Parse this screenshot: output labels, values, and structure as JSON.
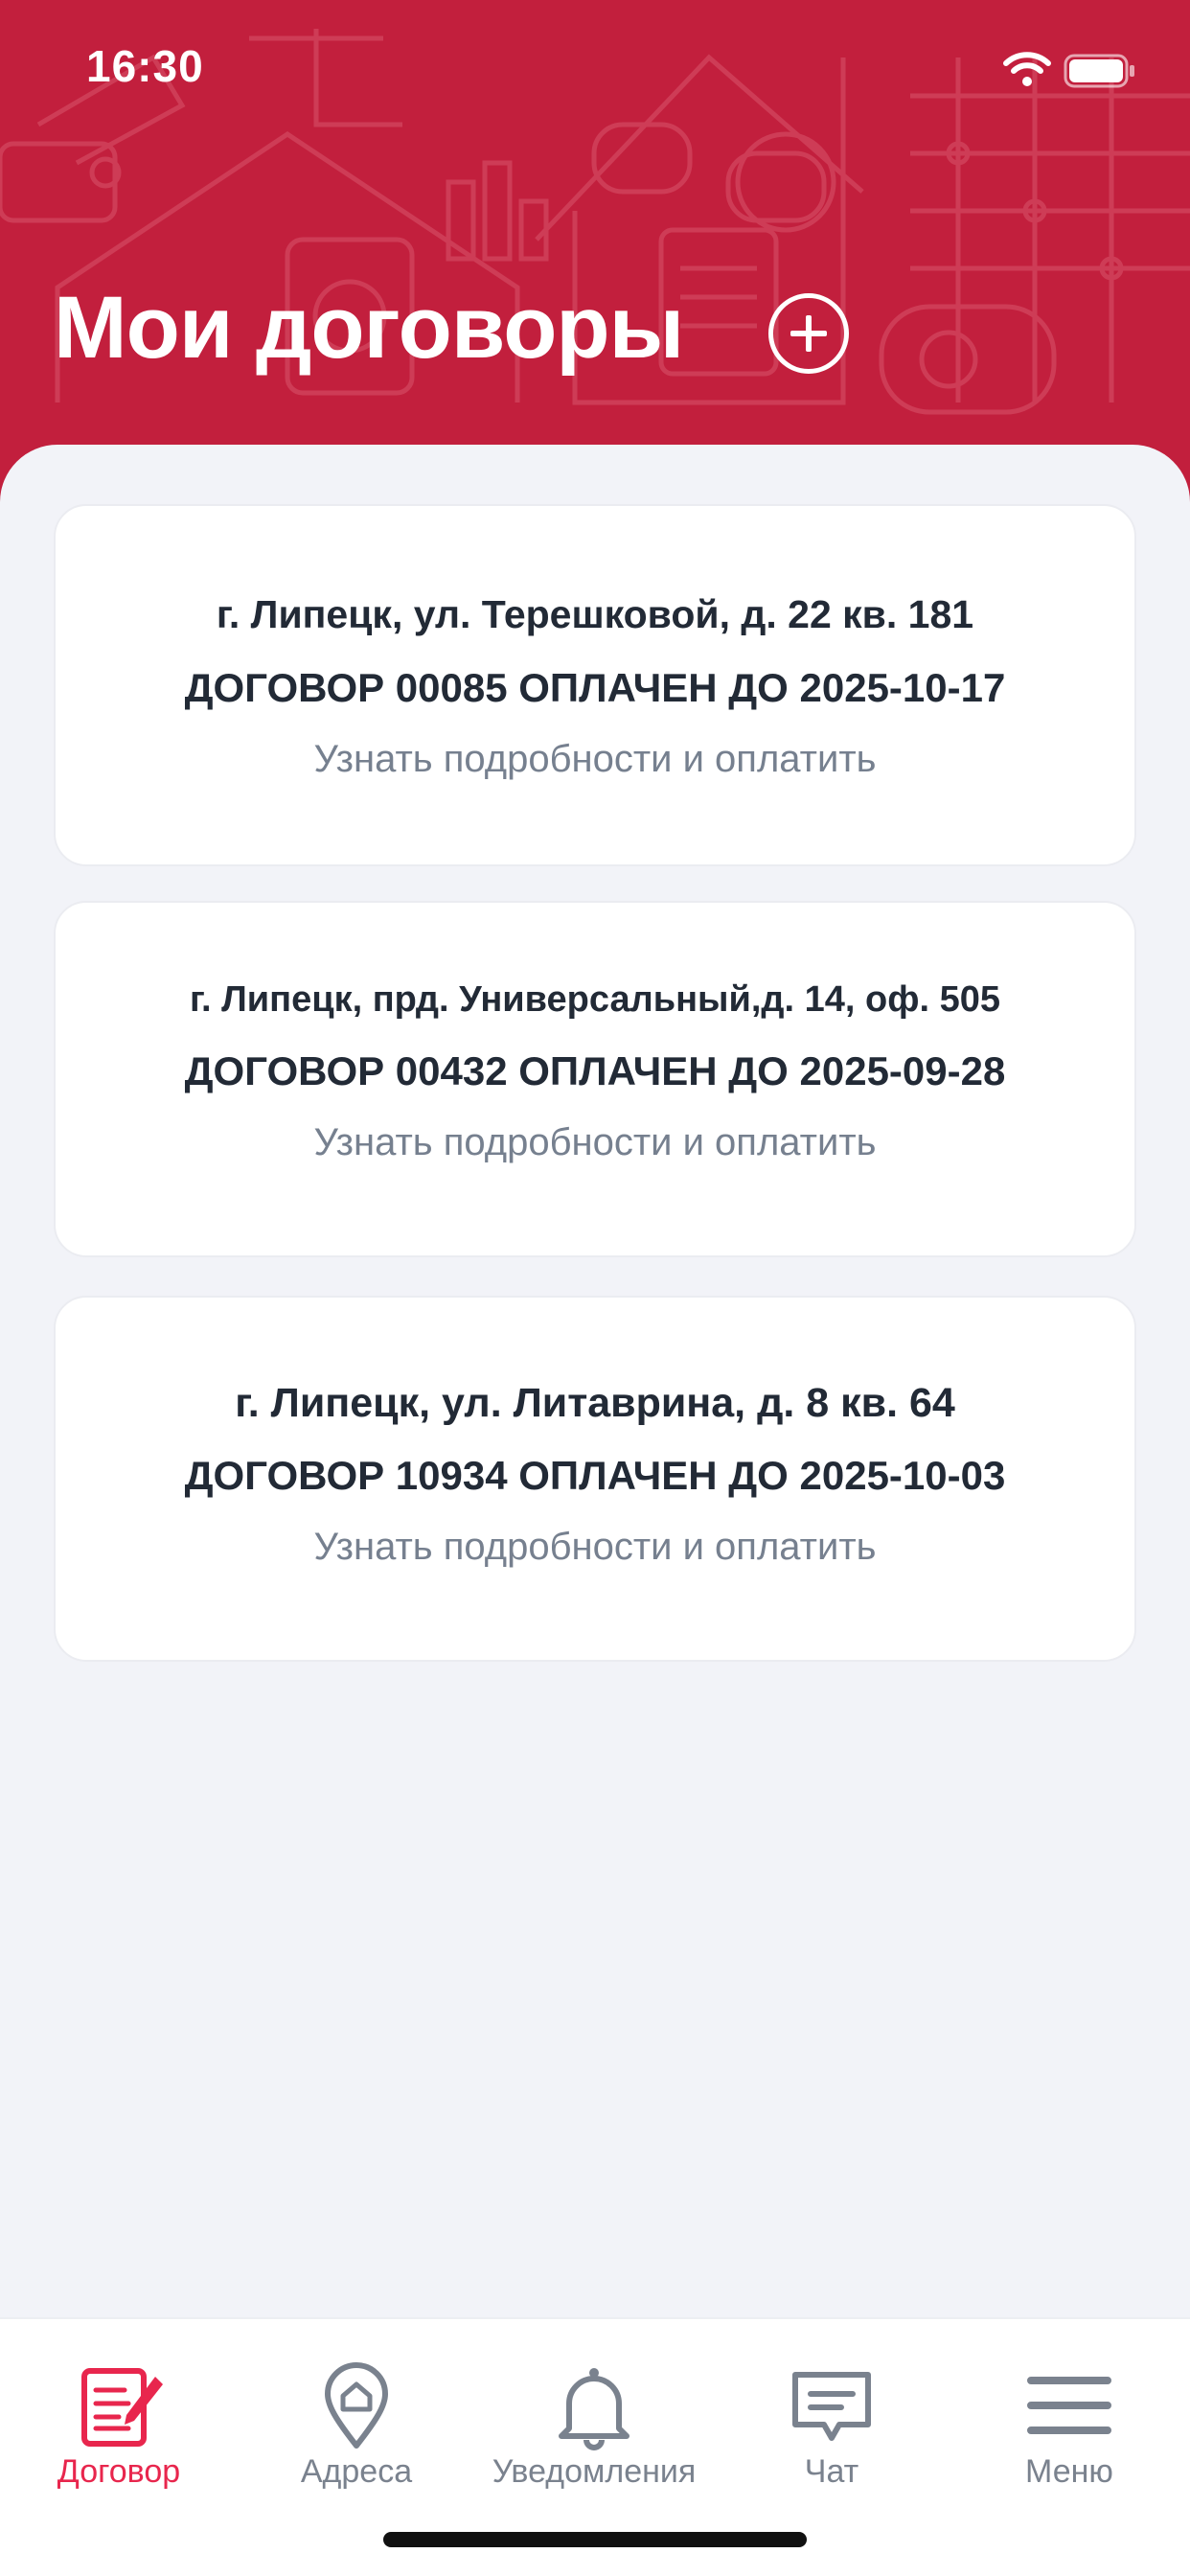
{
  "status_bar": {
    "time": "16:30",
    "icons": [
      "wifi-icon",
      "battery-icon"
    ]
  },
  "header": {
    "title": "Мои договоры",
    "add_icon": "plus-circle-icon",
    "background_color": "#c21f3d"
  },
  "contracts": [
    {
      "address": "г. Липецк, ул. Терешковой, д. 22 кв. 181",
      "status": "ДОГОВОР 00085 ОПЛАЧЕН ДО 2025-10-17",
      "link": "Узнать подробности и оплатить"
    },
    {
      "address": "г. Липецк, прд. Универсальный,д. 14, оф. 505",
      "status": "ДОГОВОР 00432 ОПЛАЧЕН ДО 2025-09-28",
      "link": "Узнать подробности и оплатить"
    },
    {
      "address": "г. Липецк, ул. Литаврина, д. 8 кв. 64",
      "status": "ДОГОВОР 10934 ОПЛАЧЕН ДО 2025-10-03",
      "link": "Узнать подробности и оплатить"
    }
  ],
  "tabbar": {
    "active_color": "#e8264d",
    "inactive_color": "#7a828e",
    "tabs": [
      {
        "label": "Договор",
        "icon": "contract-edit-icon",
        "active": true
      },
      {
        "label": "Адреса",
        "icon": "location-home-icon",
        "active": false
      },
      {
        "label": "Уведомления",
        "icon": "bell-icon",
        "active": false
      },
      {
        "label": "Чат",
        "icon": "chat-icon",
        "active": false
      },
      {
        "label": "Меню",
        "icon": "menu-icon",
        "active": false
      }
    ]
  }
}
